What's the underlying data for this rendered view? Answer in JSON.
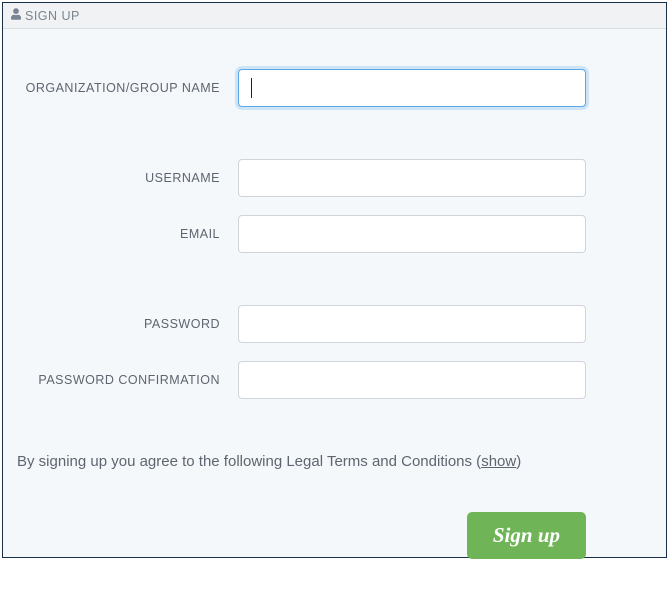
{
  "header": {
    "title": "SIGN UP"
  },
  "form": {
    "org_label": "ORGANIZATION/GROUP NAME",
    "org_value": "",
    "username_label": "USERNAME",
    "username_value": "",
    "email_label": "EMAIL",
    "email_value": "",
    "password_label": "PASSWORD",
    "password_value": "",
    "password_confirm_label": "PASSWORD CONFIRMATION",
    "password_confirm_value": ""
  },
  "terms": {
    "prefix": "By signing up you agree to the following Legal Terms and Conditions (",
    "show": "show",
    "suffix": ")"
  },
  "buttons": {
    "signup": "Sign up"
  }
}
